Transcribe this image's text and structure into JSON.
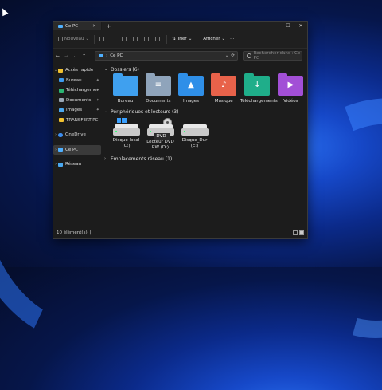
{
  "window": {
    "tab_title": "Ce PC",
    "tab_close": "✕",
    "new_tab": "+",
    "controls": {
      "minimize": "—",
      "maximize": "☐",
      "close": "✕"
    }
  },
  "toolbar": {
    "new_label": "Nouveau",
    "new_chevron": "⌄",
    "sort_label": "Trier",
    "view_label": "Afficher",
    "more_label": "···"
  },
  "nav": {
    "back": "←",
    "forward": "→",
    "up": "↑",
    "refresh": "⟳",
    "dropdown": "⌄"
  },
  "address": {
    "path": "Ce PC",
    "chevron": "›"
  },
  "search": {
    "placeholder": "Rechercher dans : Ce PC"
  },
  "sidebar": {
    "items": [
      {
        "label": "Accès rapide",
        "chevron": "⌄",
        "color": "#f2c230"
      },
      {
        "label": "Bureau",
        "color": "#3d9bf0",
        "pin": "📌"
      },
      {
        "label": "Téléchargemen",
        "color": "#2bb673",
        "pin": "📌"
      },
      {
        "label": "Documents",
        "color": "#9aa7b5",
        "pin": "📌"
      },
      {
        "label": "Images",
        "color": "#4aa8f0",
        "pin": "📌"
      },
      {
        "label": "TRANSFERT-PC",
        "color": "#f2c230"
      },
      {
        "label": "OneDrive",
        "chevron": "›",
        "color": "#3d8ef0"
      },
      {
        "label": "Ce PC",
        "chevron": "›",
        "color": "#4fb0ff"
      },
      {
        "label": "Réseau",
        "chevron": "›",
        "color": "#4aa8f0"
      }
    ]
  },
  "sections": {
    "folders_title": "Dossiers (6)",
    "devices_title": "Périphériques et lecteurs (3)",
    "network_title": "Emplacements réseau (1)",
    "expanded_chevron": "⌄",
    "collapsed_chevron": "›"
  },
  "folders": [
    {
      "label": "Bureau",
      "color": "#3fa0ef",
      "glyph": ""
    },
    {
      "label": "Documents",
      "color": "#8fa4bb",
      "glyph": "≡"
    },
    {
      "label": "Images",
      "color": "#2f8fe8",
      "glyph": "▲"
    },
    {
      "label": "Musique",
      "color": "#e8624a",
      "glyph": "♪"
    },
    {
      "label": "Téléchargements",
      "color": "#1fae8a",
      "glyph": "↓"
    },
    {
      "label": "Vidéos",
      "color": "#a24fd6",
      "glyph": "▶"
    }
  ],
  "drives": [
    {
      "label": "Disque local (C:)"
    },
    {
      "label": "Lecteur DVD RW (D:)",
      "badge": "DVD"
    },
    {
      "label": "Disque_Dur (E:)"
    }
  ],
  "status": {
    "count": "10 élément(s)",
    "separator": "|"
  }
}
